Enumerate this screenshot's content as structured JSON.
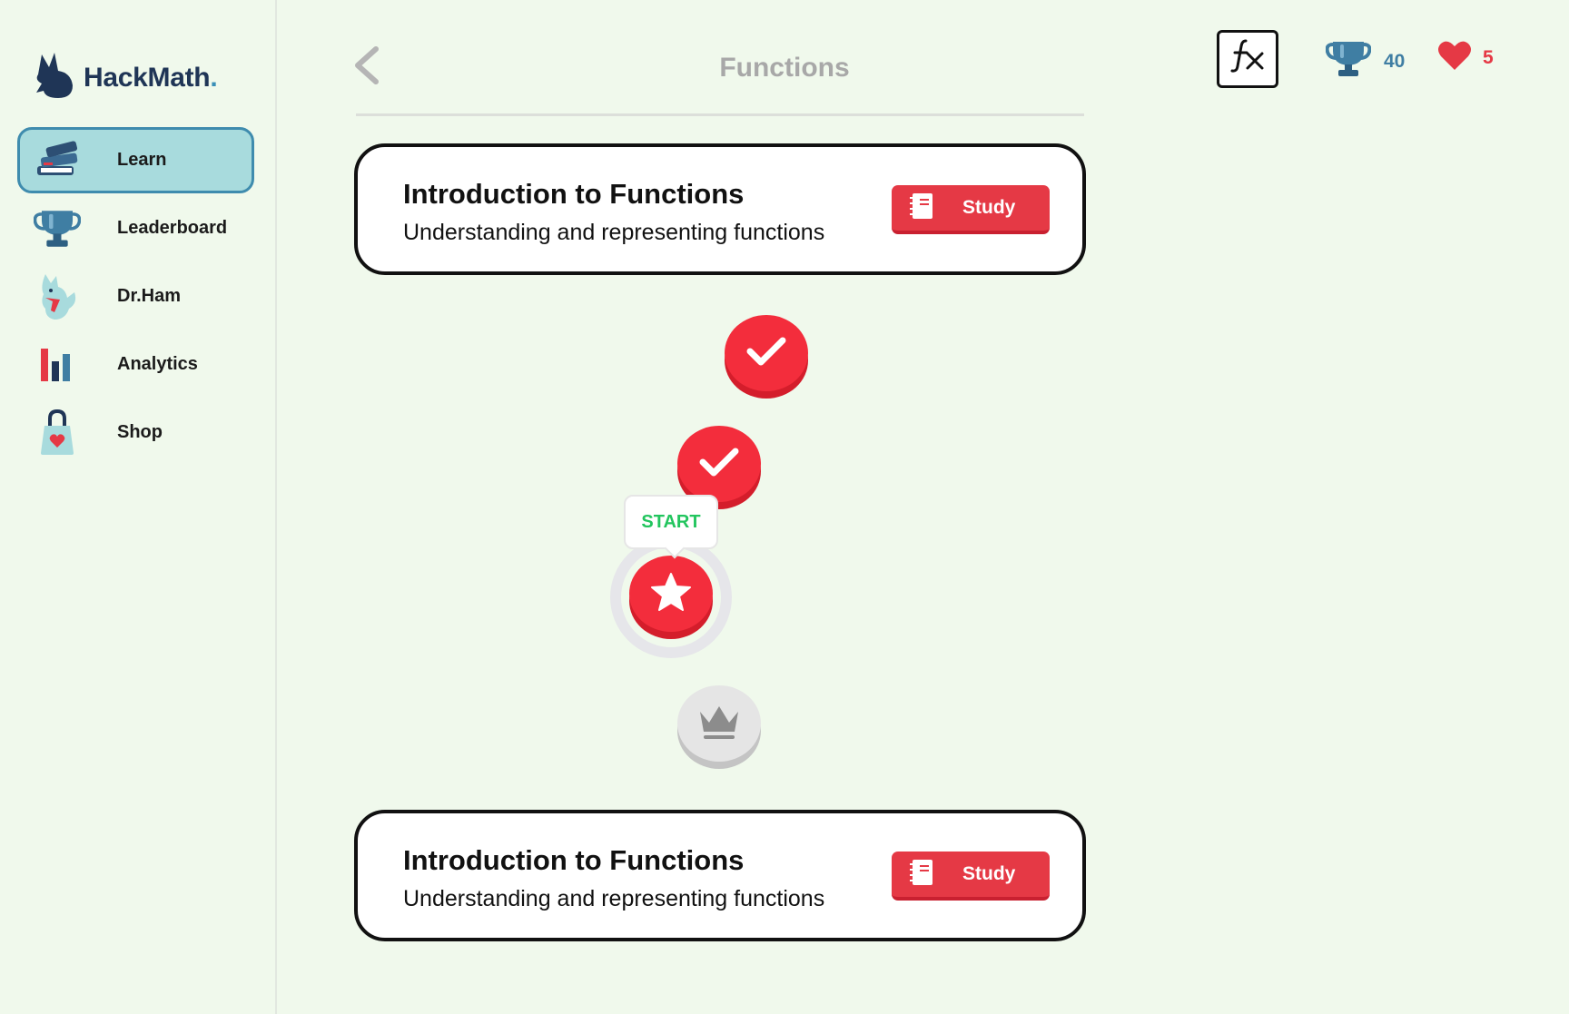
{
  "app": {
    "name": "HackMath",
    "name_dot": "."
  },
  "sidebar": {
    "items": [
      {
        "label": "Learn",
        "icon": "books-icon",
        "active": true
      },
      {
        "label": "Leaderboard",
        "icon": "trophy-icon",
        "active": false
      },
      {
        "label": "Dr.Ham",
        "icon": "hamster-mascot-icon",
        "active": false
      },
      {
        "label": "Analytics",
        "icon": "bar-chart-icon",
        "active": false
      },
      {
        "label": "Shop",
        "icon": "shopping-bag-icon",
        "active": false
      }
    ]
  },
  "header": {
    "title": "Functions",
    "trophy_count": "40",
    "hearts_count": "5"
  },
  "units": [
    {
      "title": "Introduction to Functions",
      "subtitle": "Understanding and representing functions",
      "study_label": "Study"
    },
    {
      "title": "Introduction to Functions",
      "subtitle": "Understanding and representing functions",
      "study_label": "Study"
    }
  ],
  "path": {
    "start_label": "START",
    "nodes": [
      {
        "state": "completed",
        "icon": "check-icon"
      },
      {
        "state": "completed",
        "icon": "check-icon"
      },
      {
        "state": "current",
        "icon": "star-icon"
      },
      {
        "state": "locked",
        "icon": "crown-icon"
      }
    ]
  },
  "colors": {
    "background": "#f0f9ec",
    "accent_red": "#f32d3c",
    "active_nav_bg": "#a8dbdd",
    "active_nav_border": "#3f8cae",
    "start_green": "#22c55e",
    "brand_navy": "#1f3556"
  }
}
